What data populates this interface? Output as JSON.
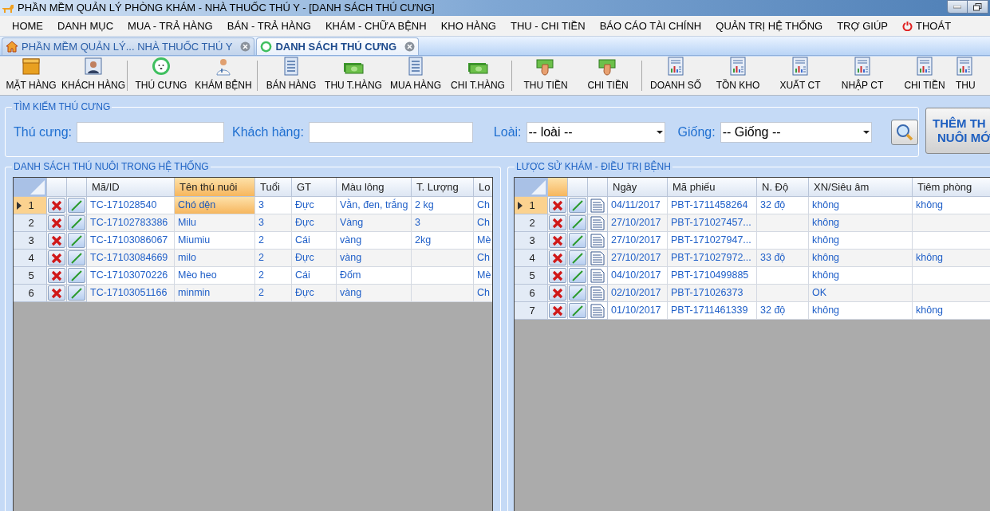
{
  "window": {
    "title": "PHẦN MỀM QUẢN LÝ PHÒNG KHÁM - NHÀ THUỐC THÚ Y - [DANH SÁCH THÚ CƯNG]"
  },
  "menu": [
    {
      "label": "HOME",
      "kind": "text"
    },
    {
      "label": "DANH MỤC",
      "kind": "text"
    },
    {
      "label": "MUA - TRẢ HÀNG",
      "kind": "text"
    },
    {
      "label": "BÁN - TRẢ HÀNG",
      "kind": "text"
    },
    {
      "label": "KHÁM - CHỮA BỆNH",
      "kind": "text"
    },
    {
      "label": "KHO HÀNG",
      "kind": "text"
    },
    {
      "label": "THU - CHI TIỀN",
      "kind": "text"
    },
    {
      "label": "BÁO CÁO TÀI CHÍNH",
      "kind": "text"
    },
    {
      "label": "QUẢN TRỊ HỆ THỐNG",
      "kind": "text"
    },
    {
      "label": "TRỢ GIÚP",
      "kind": "text"
    },
    {
      "label": "THOÁT",
      "kind": "exit"
    }
  ],
  "tabs": [
    {
      "label": "PHẦN MỀM QUẢN LÝ... NHÀ THUỐC THÚ Y",
      "kind": "home",
      "selected": false
    },
    {
      "label": "DANH SÁCH THÚ CƯNG",
      "kind": "pet",
      "selected": true
    }
  ],
  "toolbar": [
    [
      {
        "label": "MẶT HÀNG",
        "kind": "box"
      },
      {
        "label": "KHÁCH HÀNG",
        "kind": "person"
      }
    ],
    [
      {
        "label": "THÚ CƯNG",
        "kind": "pet"
      },
      {
        "label": "KHÁM BỆNH",
        "kind": "doctor"
      }
    ],
    [
      {
        "label": "BÁN HÀNG",
        "kind": "list"
      },
      {
        "label": "THU T.HÀNG",
        "kind": "money"
      },
      {
        "label": "MUA HÀNG",
        "kind": "list"
      },
      {
        "label": "CHI T.HÀNG",
        "kind": "money"
      }
    ],
    [
      {
        "label": "THU TIỀN",
        "kind": "hand"
      },
      {
        "label": "CHI TIỀN",
        "kind": "hand"
      }
    ],
    [
      {
        "label": "DOANH SỐ",
        "kind": "report"
      },
      {
        "label": "TỒN KHO",
        "kind": "report"
      },
      {
        "label": "XUẤT CT",
        "kind": "report"
      },
      {
        "label": "NHẬP CT",
        "kind": "report"
      },
      {
        "label": "CHI TIỀN",
        "kind": "report"
      },
      {
        "label": "THU",
        "kind": "report"
      }
    ]
  ],
  "search": {
    "title": "TÌM KIẾM THÚ CƯNG",
    "fields": [
      {
        "label": "Thú cưng:",
        "kind": "text"
      },
      {
        "label": "Khách hàng:",
        "kind": "text"
      },
      {
        "label": "Loài:",
        "kind": "select",
        "value": "-- loài --"
      },
      {
        "label": "Giống:",
        "kind": "select",
        "value": "-- Giống --"
      }
    ],
    "add_button": [
      "THÊM TH",
      "NUÔI MỚ"
    ]
  },
  "pets": {
    "title": "DANH SÁCH THÚ NUÔI TRONG HỆ THỐNG",
    "action_header_selected": false,
    "columns": [
      {
        "label": "Mã/ID",
        "selected": false
      },
      {
        "label": "Tên thú nuôi",
        "selected": true
      },
      {
        "label": "Tuổi",
        "selected": false
      },
      {
        "label": "GT",
        "selected": false
      },
      {
        "label": "Màu lông",
        "selected": false
      },
      {
        "label": "T. Lượng",
        "selected": false
      },
      {
        "label": "Lo",
        "selected": false
      }
    ],
    "rows": [
      {
        "number": "1",
        "selected": true,
        "cells": [
          "TC-171028540",
          "Chó dện",
          "3",
          "Đực",
          "Vằn, đen, trắng",
          "2 kg",
          "Ch"
        ]
      },
      {
        "number": "2",
        "selected": false,
        "cells": [
          "TC-17102783386",
          "Milu",
          "3",
          "Đực",
          "Vàng",
          "3",
          "Ch"
        ]
      },
      {
        "number": "3",
        "selected": false,
        "cells": [
          "TC-17103086067",
          "Miumiu",
          "2",
          "Cái",
          "vàng",
          "2kg",
          "Mè"
        ]
      },
      {
        "number": "4",
        "selected": false,
        "cells": [
          "TC-17103084669",
          "milo",
          "2",
          "Đực",
          "vàng",
          "",
          "Ch"
        ]
      },
      {
        "number": "5",
        "selected": false,
        "cells": [
          "TC-17103070226",
          "Mèo heo",
          "2",
          "Cái",
          "Đốm",
          "",
          "Mè"
        ]
      },
      {
        "number": "6",
        "selected": false,
        "cells": [
          "TC-17103051166",
          "minmin",
          "2",
          "Đực",
          "vàng",
          "",
          "Ch"
        ]
      }
    ]
  },
  "history": {
    "title": "LƯỢC SỬ KHÁM - ĐIỀU TRỊ BỆNH",
    "action_header_selected": true,
    "columns": [
      {
        "label": "Ngày",
        "selected": false
      },
      {
        "label": "Mã phiếu",
        "selected": false
      },
      {
        "label": "N. Độ",
        "selected": false
      },
      {
        "label": "XN/Siêu âm",
        "selected": false
      },
      {
        "label": "Tiêm phòng",
        "selected": false
      }
    ],
    "rows": [
      {
        "number": "1",
        "selected": true,
        "cells": [
          "04/11/2017",
          "PBT-1711458264",
          "32 độ",
          "không",
          "không"
        ]
      },
      {
        "number": "2",
        "selected": false,
        "cells": [
          "27/10/2017",
          "PBT-171027457...",
          "",
          "không",
          ""
        ]
      },
      {
        "number": "3",
        "selected": false,
        "cells": [
          "27/10/2017",
          "PBT-171027947...",
          "",
          "không",
          ""
        ]
      },
      {
        "number": "4",
        "selected": false,
        "cells": [
          "27/10/2017",
          "PBT-171027972...",
          "33 độ",
          "không",
          "không"
        ]
      },
      {
        "number": "5",
        "selected": false,
        "cells": [
          "04/10/2017",
          "PBT-1710499885",
          "",
          "không",
          ""
        ]
      },
      {
        "number": "6",
        "selected": false,
        "cells": [
          "02/10/2017",
          "PBT-171026373",
          "",
          "OK",
          ""
        ]
      },
      {
        "number": "7",
        "selected": false,
        "cells": [
          "01/10/2017",
          "PBT-1711461339",
          "32 độ",
          "không",
          "không"
        ]
      }
    ]
  }
}
